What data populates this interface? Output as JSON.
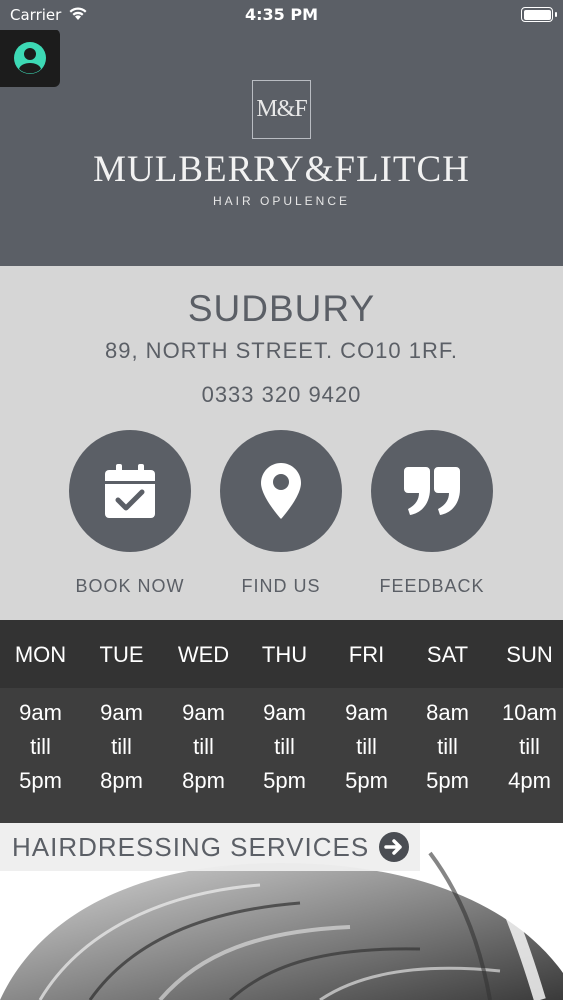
{
  "status": {
    "carrier": "Carrier",
    "time": "4:35 PM"
  },
  "header": {
    "monogram": "M&F",
    "brand": "MULBERRY&FLITCH",
    "tagline": "HAIR OPULENCE"
  },
  "location": {
    "city": "SUDBURY",
    "address": "89, NORTH STREET. CO10 1RF.",
    "phone": "0333 320 9420"
  },
  "actions": {
    "book": "BOOK NOW",
    "find": "FIND US",
    "feedback": "FEEDBACK"
  },
  "hours": [
    {
      "day": "MON",
      "open": "9am",
      "sep": "till",
      "close": "5pm"
    },
    {
      "day": "TUE",
      "open": "9am",
      "sep": "till",
      "close": "8pm"
    },
    {
      "day": "WED",
      "open": "9am",
      "sep": "till",
      "close": "8pm"
    },
    {
      "day": "THU",
      "open": "9am",
      "sep": "till",
      "close": "5pm"
    },
    {
      "day": "FRI",
      "open": "9am",
      "sep": "till",
      "close": "5pm"
    },
    {
      "day": "SAT",
      "open": "8am",
      "sep": "till",
      "close": "5pm"
    },
    {
      "day": "SUN",
      "open": "10am",
      "sep": "till",
      "close": "4pm"
    }
  ],
  "services": {
    "label": "HAIRDRESSING SERVICES"
  },
  "colors": {
    "slate": "#5b5f66",
    "accent": "#3dd9b5",
    "dark": "#333333"
  }
}
